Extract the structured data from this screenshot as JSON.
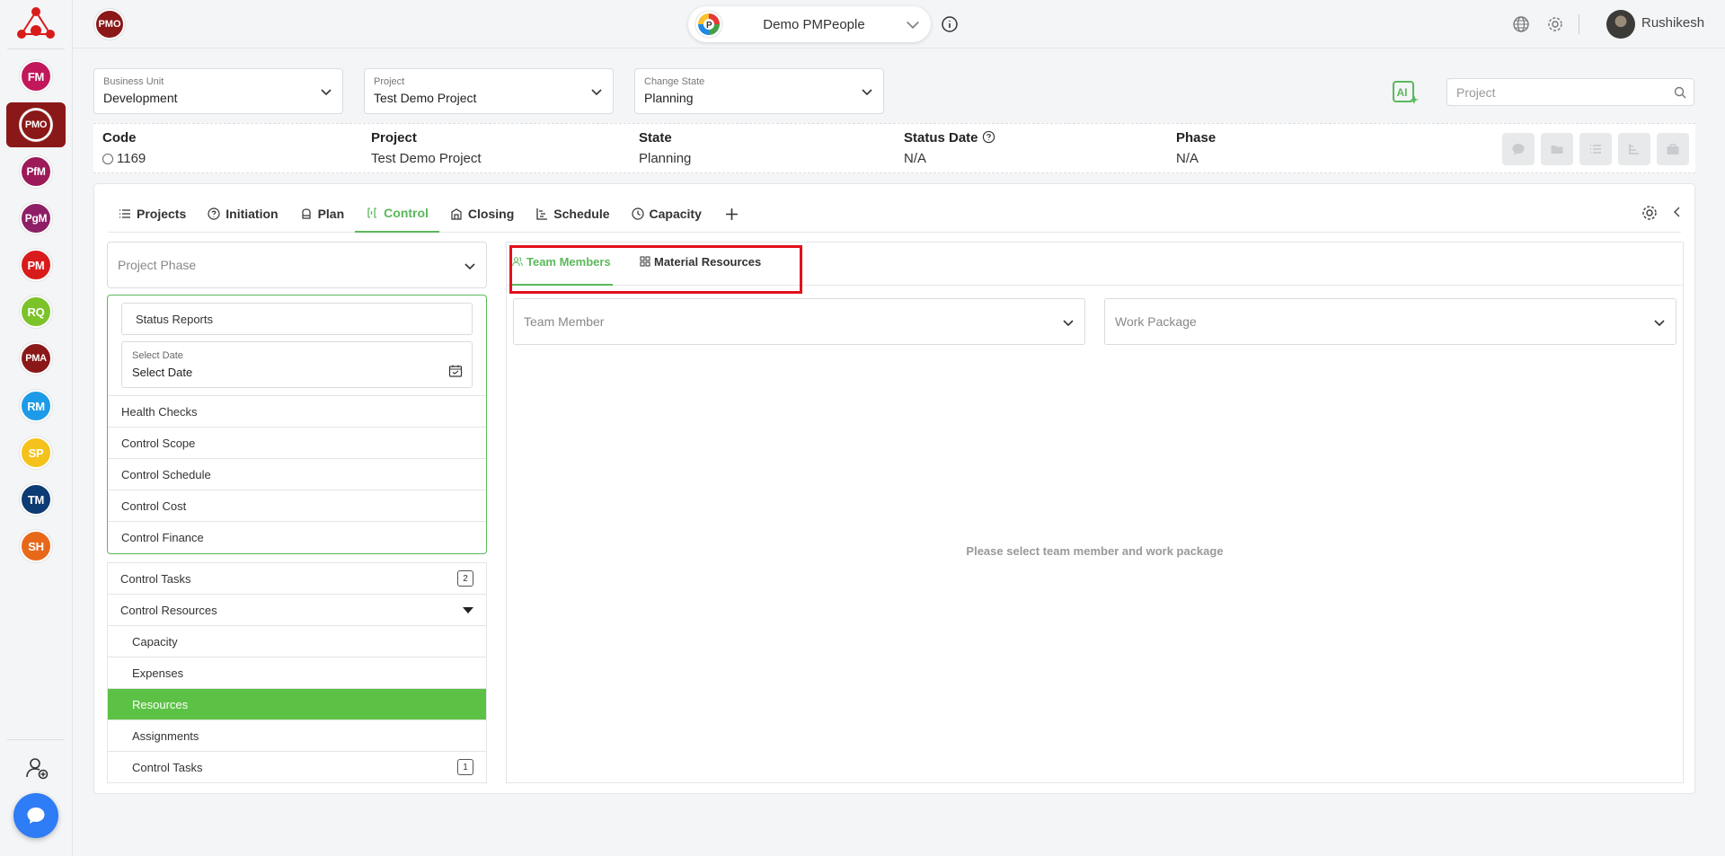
{
  "rail": {
    "modules": [
      {
        "label": "FM",
        "color": "#c2185b"
      },
      {
        "label": "PMO",
        "color": "#8b1818"
      },
      {
        "label": "PfM",
        "color": "#9c1a5a"
      },
      {
        "label": "PgM",
        "color": "#8e1f66"
      },
      {
        "label": "PM",
        "color": "#d81b1b"
      },
      {
        "label": "RQ",
        "color": "#7cc32a"
      },
      {
        "label": "PMA",
        "color": "#8b1818"
      },
      {
        "label": "RM",
        "color": "#1e9be8"
      },
      {
        "label": "SP",
        "color": "#f5c21b"
      },
      {
        "label": "TM",
        "color": "#0d3b73"
      },
      {
        "label": "SH",
        "color": "#e8681a"
      }
    ],
    "active": "PMO"
  },
  "topbar": {
    "badge": "PMO",
    "app_selector": "Demo PMPeople",
    "user_name": "Rushikesh"
  },
  "filters": {
    "business_unit": {
      "caption": "Business Unit",
      "value": "Development"
    },
    "project": {
      "caption": "Project",
      "value": "Test Demo Project"
    },
    "change_state": {
      "caption": "Change State",
      "value": "Planning"
    },
    "search_placeholder": "Project",
    "ai_label": "AI"
  },
  "info": {
    "code": {
      "label": "Code",
      "value": "1169"
    },
    "project": {
      "label": "Project",
      "value": "Test Demo Project"
    },
    "state": {
      "label": "State",
      "value": "Planning"
    },
    "status_date": {
      "label": "Status Date",
      "value": "N/A"
    },
    "phase": {
      "label": "Phase",
      "value": "N/A"
    }
  },
  "tabs": [
    {
      "label": "Projects",
      "icon": "list-icon"
    },
    {
      "label": "Initiation",
      "icon": "question-circle-icon"
    },
    {
      "label": "Plan",
      "icon": "plan-icon"
    },
    {
      "label": "Control",
      "icon": "control-icon",
      "active": true
    },
    {
      "label": "Closing",
      "icon": "closing-icon"
    },
    {
      "label": "Schedule",
      "icon": "schedule-icon"
    },
    {
      "label": "Capacity",
      "icon": "clock-icon"
    }
  ],
  "left": {
    "phase_placeholder": "Project Phase",
    "status_reports": "Status Reports",
    "select_date_caption": "Select Date",
    "select_date_value": "Select Date",
    "group_items": [
      "Health Checks",
      "Control Scope",
      "Control Schedule",
      "Control Cost",
      "Control Finance"
    ],
    "list": {
      "control_tasks": {
        "label": "Control Tasks",
        "count": "2"
      },
      "control_resources": "Control Resources",
      "sub_items": [
        "Capacity",
        "Expenses",
        "Resources",
        "Assignments"
      ],
      "selected": "Resources",
      "sub_control_tasks": {
        "label": "Control Tasks",
        "count": "1"
      }
    }
  },
  "right": {
    "sub_tabs": [
      "Team Members",
      "Material Resources"
    ],
    "team_member_placeholder": "Team Member",
    "work_package_placeholder": "Work Package",
    "empty_message": "Please select team member and work package"
  },
  "colors": {
    "accent_green": "#5cb85c",
    "highlight_red": "#e3101a",
    "brand_red": "#8b1818"
  }
}
